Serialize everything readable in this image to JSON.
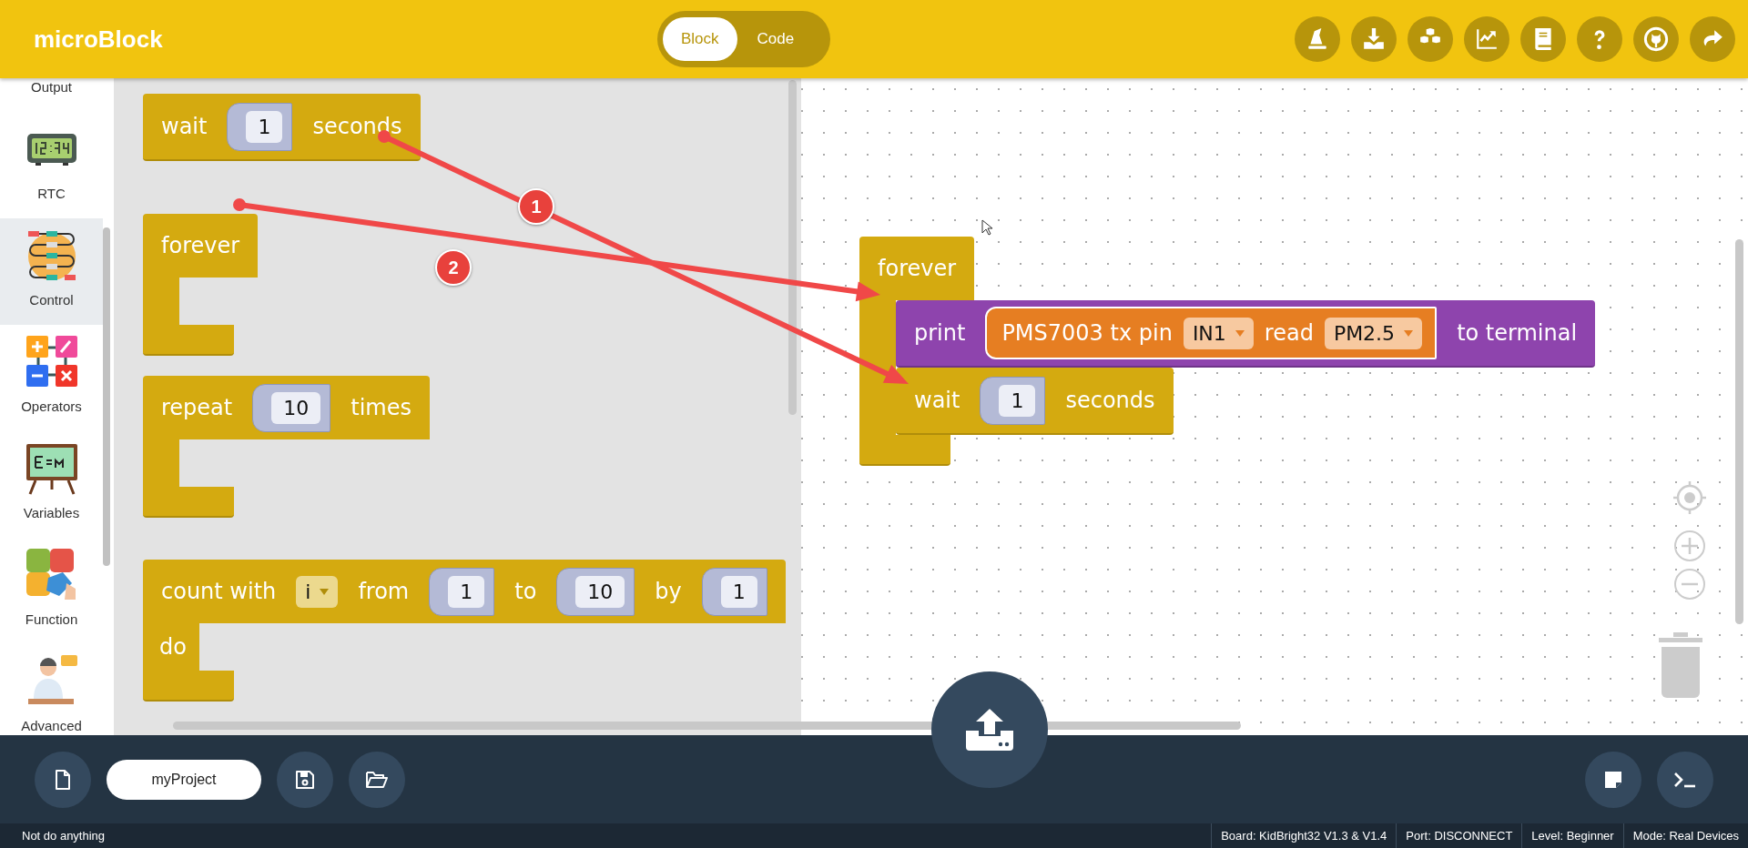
{
  "app_title": "microBlock",
  "view_tabs": [
    {
      "label": "Block",
      "selected": true
    },
    {
      "label": "Code",
      "selected": false
    }
  ],
  "sidebar": {
    "items": [
      {
        "label": "Output",
        "selected": false
      },
      {
        "label": "RTC",
        "selected": false
      },
      {
        "label": "Control",
        "selected": true
      },
      {
        "label": "Operators",
        "selected": false
      },
      {
        "label": "Variables",
        "selected": false
      },
      {
        "label": "Function",
        "selected": false
      },
      {
        "label": "Advanced",
        "selected": false
      }
    ]
  },
  "palette_blocks": [
    {
      "kind": "statement",
      "parts": [
        {
          "kind": "text",
          "text": "wait"
        },
        {
          "kind": "number",
          "text": "1"
        },
        {
          "kind": "text",
          "text": "seconds"
        }
      ]
    },
    {
      "kind": "c-block",
      "parts": [
        {
          "kind": "text",
          "text": "forever"
        }
      ]
    },
    {
      "kind": "c-block",
      "parts": [
        {
          "kind": "text",
          "text": "repeat"
        },
        {
          "kind": "number",
          "text": "10"
        },
        {
          "kind": "text",
          "text": "times"
        }
      ]
    },
    {
      "kind": "c-block",
      "parts": [
        {
          "kind": "text",
          "text": "count with"
        },
        {
          "kind": "dropdown",
          "text": "i"
        },
        {
          "kind": "text",
          "text": "from"
        },
        {
          "kind": "number",
          "text": "1"
        },
        {
          "kind": "text",
          "text": "to"
        },
        {
          "kind": "number",
          "text": "10"
        },
        {
          "kind": "text",
          "text": "by"
        },
        {
          "kind": "number",
          "text": "1"
        }
      ],
      "footer": "do"
    }
  ],
  "workspace_blocks": [
    {
      "kind": "c-block",
      "parts": [
        {
          "kind": "text",
          "text": "forever"
        }
      ],
      "children": [
        {
          "kind": "print",
          "parts": [
            {
              "kind": "text",
              "text": "print"
            },
            {
              "kind": "reporter",
              "parts": [
                {
                  "kind": "text",
                  "text": "PMS7003 tx pin"
                },
                {
                  "kind": "dropdown",
                  "text": "IN1"
                },
                {
                  "kind": "text",
                  "text": "read"
                },
                {
                  "kind": "dropdown",
                  "text": "PM2.5"
                }
              ]
            },
            {
              "kind": "text",
              "text": "to terminal"
            }
          ]
        },
        {
          "kind": "statement",
          "parts": [
            {
              "kind": "text",
              "text": "wait"
            },
            {
              "kind": "number",
              "text": "1"
            },
            {
              "kind": "text",
              "text": "seconds"
            }
          ]
        }
      ]
    }
  ],
  "annotations": [
    {
      "label": "1"
    },
    {
      "label": "2"
    }
  ],
  "project_name": "myProject",
  "status_bar": {
    "message": "Not do anything",
    "items": [
      "Board: KidBright32 V1.3 & V1.4",
      "Port: DISCONNECT",
      "Level: Beginner",
      "Mode: Real Devices"
    ]
  }
}
